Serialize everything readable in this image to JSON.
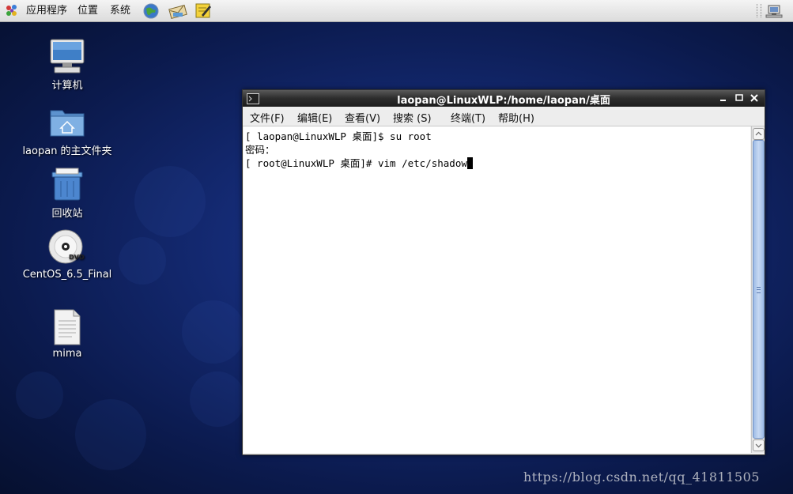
{
  "top_panel": {
    "menus": [
      "应用程序",
      "位置",
      "系统"
    ],
    "launchers": [
      "web-browser-icon",
      "email-client-icon",
      "notes-editor-icon"
    ],
    "tray": "network-icon"
  },
  "desktop_icons": [
    {
      "label": "计算机",
      "icon": "computer-icon"
    },
    {
      "label": "laopan 的主文件夹",
      "icon": "home-folder-icon"
    },
    {
      "label": "回收站",
      "icon": "trash-icon"
    },
    {
      "label": "CentOS_6.5_Final",
      "icon": "dvd-icon"
    },
    {
      "label": "mima",
      "icon": "text-file-icon"
    }
  ],
  "terminal": {
    "title": "laopan@LinuxWLP:/home/laopan/桌面",
    "menu": [
      "文件(F)",
      "编辑(E)",
      "查看(V)",
      "搜索 (S)",
      "终端(T)",
      "帮助(H)"
    ],
    "lines": [
      "[ laopan@LinuxWLP 桌面]$ su root",
      "密码：",
      "[ root@LinuxWLP 桌面]# vim /etc/shadow"
    ]
  },
  "watermark": "https://blog.csdn.net/qq_41811505",
  "colors": {
    "desktop_bg": "#142a73",
    "titlebar": "#2c2c2c",
    "scroll_thumb": "#9dbbe6"
  }
}
